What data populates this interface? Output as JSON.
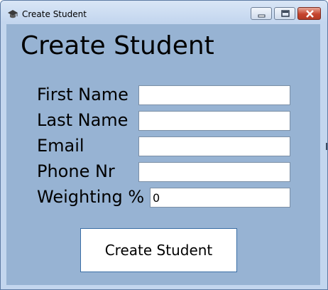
{
  "window": {
    "title": "Create Student",
    "icon": "graduation-cap-icon",
    "controls": [
      "minimize-icon",
      "maximize-icon",
      "close-icon"
    ]
  },
  "form": {
    "heading": "Create Student",
    "fields": [
      {
        "label": "First Name",
        "value": ""
      },
      {
        "label": "Last Name",
        "value": ""
      },
      {
        "label": "Email",
        "value": ""
      },
      {
        "label": "Phone Nr",
        "value": ""
      },
      {
        "label": "Weighting %",
        "value": "0"
      }
    ],
    "submit_label": "Create Student"
  },
  "colors": {
    "client_background": "#97b3d3",
    "close_button": "#c6452e",
    "button_border": "#3a6ea5"
  }
}
